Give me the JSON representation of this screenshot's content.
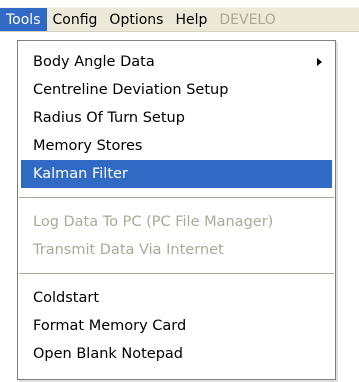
{
  "colors": {
    "accent": "#316ac5",
    "disabled_text": "#aca899",
    "menubar_bg": "#ece9d8"
  },
  "menubar": {
    "items": [
      {
        "label": "Tools",
        "state": "active"
      },
      {
        "label": "Config",
        "state": "normal"
      },
      {
        "label": "Options",
        "state": "normal"
      },
      {
        "label": "Help",
        "state": "normal"
      },
      {
        "label": "DEVELO",
        "state": "disabled"
      }
    ]
  },
  "dropdown": {
    "group1": [
      {
        "label": "Body Angle Data",
        "has_submenu": true,
        "icon": "submenu-arrow-icon"
      },
      {
        "label": "Centreline Deviation Setup"
      },
      {
        "label": "Radius Of Turn Setup"
      },
      {
        "label": "Memory Stores"
      },
      {
        "label": "Kalman Filter",
        "highlighted": true
      }
    ],
    "group2": [
      {
        "label": "Log Data To PC (PC File Manager)",
        "disabled": true
      },
      {
        "label": "Transmit Data Via Internet",
        "disabled": true
      }
    ],
    "group3": [
      {
        "label": "Coldstart"
      },
      {
        "label": "Format Memory Card"
      },
      {
        "label": "Open Blank Notepad"
      }
    ]
  }
}
